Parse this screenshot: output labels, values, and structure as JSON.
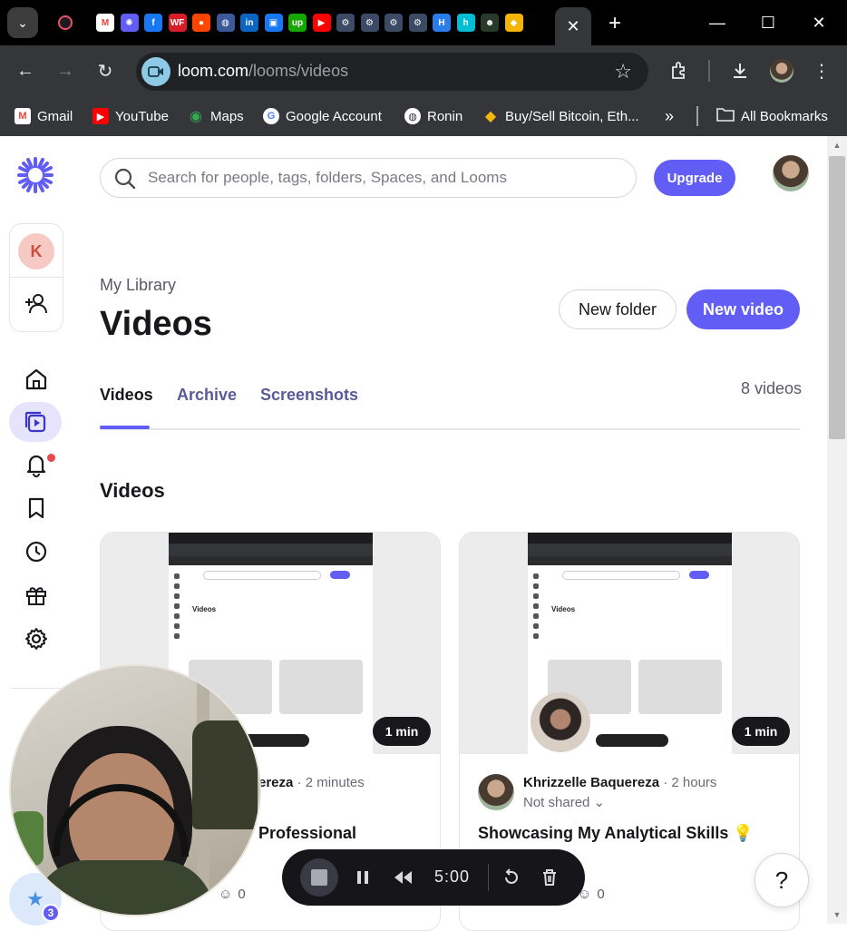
{
  "browser": {
    "tabs_favicons": [
      {
        "icon": "recording-dot-icon",
        "label": "",
        "color": "#1c1c1f"
      },
      {
        "icon": "gmail-icon",
        "label": "M",
        "color": "#ffffff"
      },
      {
        "icon": "loom-icon",
        "label": "✺",
        "color": "#625df5"
      },
      {
        "icon": "facebook-icon",
        "label": "f",
        "color": "#1877f2"
      },
      {
        "icon": "wf-icon",
        "label": "WF",
        "color": "#d71e28"
      },
      {
        "icon": "reddit-icon",
        "label": "●",
        "color": "#ff4500"
      },
      {
        "icon": "globe-icon",
        "label": "◍",
        "color": "#3b5998"
      },
      {
        "icon": "linkedin-icon",
        "label": "in",
        "color": "#0a66c2"
      },
      {
        "icon": "buffer-icon",
        "label": "▣",
        "color": "#1877f2"
      },
      {
        "icon": "upwork-icon",
        "label": "up",
        "color": "#14a800"
      },
      {
        "icon": "youtube-icon",
        "label": "▶",
        "color": "#ff0000"
      },
      {
        "icon": "openai-icon",
        "label": "⚙",
        "color": "#3b4b66"
      },
      {
        "icon": "openai-icon",
        "label": "⚙",
        "color": "#3b4b66"
      },
      {
        "icon": "openai-icon",
        "label": "⚙",
        "color": "#3b4b66"
      },
      {
        "icon": "openai-icon",
        "label": "⚙",
        "color": "#3b4b66"
      },
      {
        "icon": "hubstaff-icon",
        "label": "H",
        "color": "#2b7de9"
      },
      {
        "icon": "hubspot-icon",
        "label": "h",
        "color": "#00bcd4"
      },
      {
        "icon": "alien-icon",
        "label": "☻",
        "color": "#2a3a2a"
      },
      {
        "icon": "box-icon",
        "label": "◆",
        "color": "#f4b400"
      }
    ],
    "active_tab_close": "✕",
    "new_tab": "+",
    "url_domain": "loom.com",
    "url_path": "/looms/videos",
    "bookmarks": [
      {
        "label": "Gmail",
        "icon": "gmail-icon",
        "glyph": "M",
        "color": "#ea4335"
      },
      {
        "label": "YouTube",
        "icon": "youtube-icon",
        "glyph": "▶",
        "color": "#ff0000"
      },
      {
        "label": "Maps",
        "icon": "maps-icon",
        "glyph": "◉",
        "color": "#34a853"
      },
      {
        "label": "Google Account",
        "icon": "google-icon",
        "glyph": "G",
        "color": "#4285f4"
      },
      {
        "label": "Ronin",
        "icon": "globe-icon",
        "glyph": "◍",
        "color": "#5f6368"
      },
      {
        "label": "Buy/Sell Bitcoin, Eth...",
        "icon": "binance-icon",
        "glyph": "◆",
        "color": "#f0b90b"
      }
    ],
    "bookmarks_more": "»",
    "all_bookmarks": "All Bookmarks"
  },
  "search": {
    "placeholder": "Search for people, tags, folders, Spaces, and Looms"
  },
  "header": {
    "upgrade_label": "Upgrade"
  },
  "workspace": {
    "initial": "K"
  },
  "page": {
    "breadcrumb": "My Library",
    "title": "Videos",
    "new_folder_label": "New folder",
    "new_video_label": "New video",
    "tabs": [
      {
        "label": "Videos",
        "active": true
      },
      {
        "label": "Archive",
        "active": false
      },
      {
        "label": "Screenshots",
        "active": false
      }
    ],
    "count": "8 videos",
    "section_title": "Videos"
  },
  "cards": [
    {
      "duration": "1 min",
      "owner": "Khrizzelle Baquereza",
      "owner_visible": "ereza",
      "age": "· 2 minutes",
      "share_status": "",
      "title": "Professional",
      "reactions": "0"
    },
    {
      "duration": "1 min",
      "owner": "Khrizzelle Baquereza",
      "age": "· 2 hours",
      "share_status": "Not shared ⌄",
      "title": "Showcasing My Analytical Skills 💡",
      "reactions": "0"
    }
  ],
  "recorder": {
    "time": "5:00"
  },
  "help_label": "?",
  "perks_badge": "3",
  "colors": {
    "accent": "#625df5",
    "text": "#17171c",
    "muted": "#6a6a75"
  }
}
